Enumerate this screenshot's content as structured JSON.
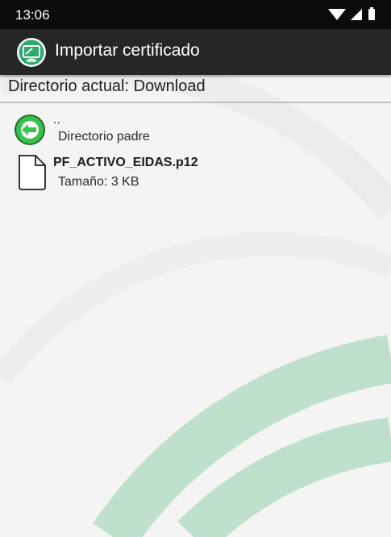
{
  "status_bar": {
    "time": "13:06",
    "icons": [
      "wifi-icon",
      "signal-icon",
      "battery-icon"
    ]
  },
  "app_bar": {
    "title": "Importar certificado",
    "icon": "certificate-app-icon"
  },
  "current_directory": {
    "label": "Directorio actual: Download"
  },
  "file_list": [
    {
      "icon": "back-arrow-icon",
      "name": "..",
      "detail": "Directorio padre"
    },
    {
      "icon": "file-icon",
      "name": "PF_ACTIVO_EIDAS.p12",
      "detail": "Tamaño: 3 KB"
    }
  ],
  "colors": {
    "status_bar": "#0c0c0c",
    "app_bar": "#262626",
    "background": "#f4f4f4",
    "accent_green": "#2fb34a",
    "watermark_green": "#bfe0cc"
  }
}
